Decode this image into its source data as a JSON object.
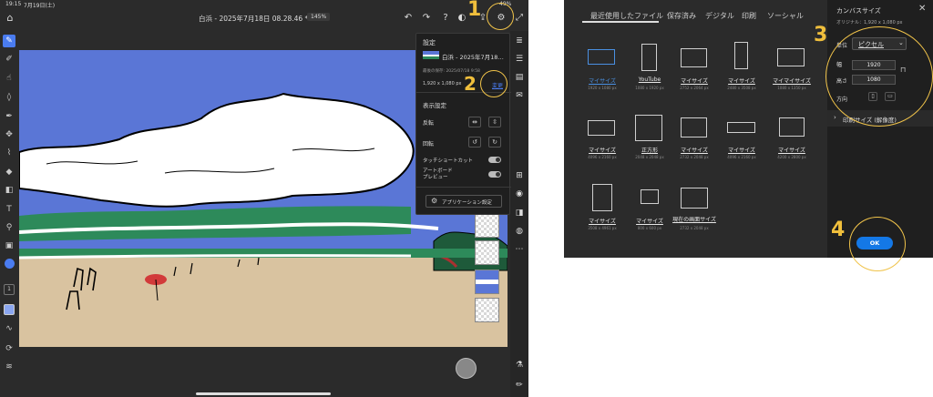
{
  "left_screenshot": {
    "status": {
      "time": "19:15",
      "date": "7月19日(土)",
      "battery": "49%"
    },
    "topbar": {
      "doc_title": "白浜 - 2025年7月18日 08.28.46 *",
      "zoom": "145%"
    },
    "settings_panel": {
      "title": "設定",
      "file_name": "白浜 - 2025年7月18…",
      "last_saved": "最後の保存: 2025/07/18 9:58",
      "dimensions": "1,920 x 1,080 px",
      "change_link": "変更",
      "display_settings": "表示設定",
      "flip_label": "反転",
      "rotate_label": "回転",
      "touch_shortcut_label": "タッチショートカット",
      "artboard_preview_label": "アートボード\nプレビュー",
      "app_settings_button": "アプリケーション設定"
    },
    "annotations": {
      "one": "1",
      "two": "2"
    },
    "colors": {
      "canvas_sky": "#5a76d6",
      "sand": "#d9c3a0",
      "grass": "#2d8a5a",
      "accent": "#4a7cf0"
    }
  },
  "right_screenshot": {
    "tabs": [
      "最近使用したファイル",
      "保存済み",
      "デジタル",
      "印刷",
      "ソーシャル"
    ],
    "presets": [
      {
        "name": "マイサイズ",
        "size": "1920 x 1080 px"
      },
      {
        "name": "YouTube",
        "size": "1080 x 1920 px"
      },
      {
        "name": "マイサイズ",
        "size": "2752 x 2064 px"
      },
      {
        "name": "マイサイズ",
        "size": "2480 x 3508 px"
      },
      {
        "name": "マイマイサイズ",
        "size": "1080 x 1350 px"
      },
      {
        "name": "マイサイズ",
        "size": "4096 x 2160 px"
      },
      {
        "name": "正方形",
        "size": "2048 x 2048 px"
      },
      {
        "name": "マイサイズ",
        "size": "2732 x 2048 px"
      },
      {
        "name": "マイサイズ",
        "size": "4096 x 2160 px"
      },
      {
        "name": "マイサイズ",
        "size": "4200 x 2800 px"
      },
      {
        "name": "マイサイズ",
        "size": "3508 x 4961 px"
      },
      {
        "name": "マイサイズ",
        "size": "800 x 600 px"
      },
      {
        "name": "現在の画面サイズ",
        "size": "2732 x 2048 px"
      }
    ],
    "canvas_panel": {
      "title": "カンバスサイズ",
      "original": "オリジナル：1,920 x 1,080 px",
      "unit_label": "単位",
      "unit_value": "ピクセル",
      "width_label": "幅",
      "width_value": "1920",
      "height_label": "高さ",
      "height_value": "1080",
      "direction_label": "方向",
      "print_size": "印刷サイズ (解像度)",
      "ok_button": "OK"
    },
    "annotations": {
      "three": "3",
      "four": "4"
    }
  }
}
